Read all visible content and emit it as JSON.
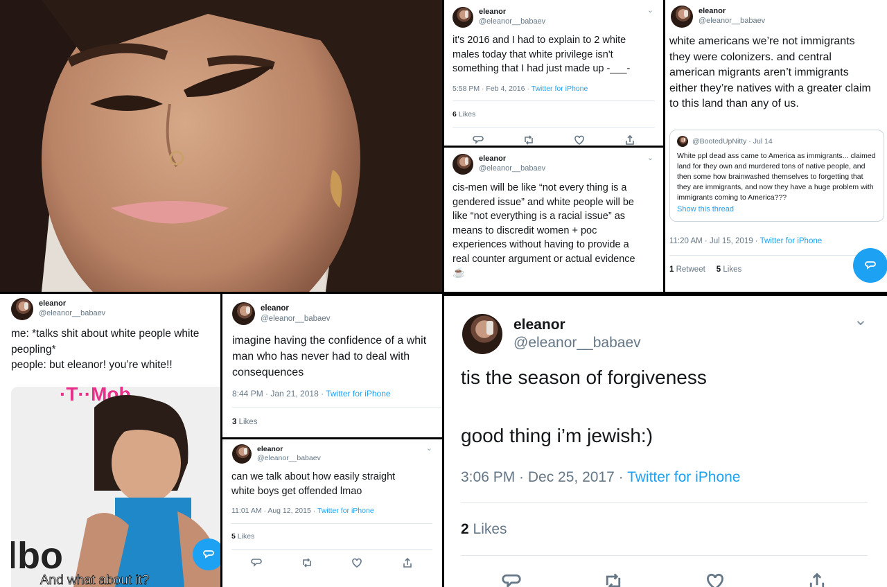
{
  "user": {
    "name": "eleanor",
    "handle": "@eleanor__babaev"
  },
  "p2": {
    "text": "it's 2016 and I had to explain to 2 white\nmales today that white privilege isn't\nsomething that I had just made up -___-",
    "time": "5:58 PM · Feb 4, 2016 · ",
    "source": "Twitter for iPhone",
    "like_count": "6",
    "like_label": "Likes"
  },
  "p3": {
    "text": "white americans we’re not immigrants\nthey were colonizers. and central\namerican migrants aren’t immigrants\neither they’re natives with a greater claim\nto this land than any of us.",
    "quote_handle": "@BootedUpNitty",
    "quote_date": "· Jul 14",
    "quote_text": "White ppl dead ass came to America as immigrants... claimed land for they own and murdered tons of native people, and then some how brainwashed themselves to forgetting that they are immigrants, and now they have a huge problem with immigrants coming to America???",
    "quote_link": "Show this thread",
    "time": "11:20 AM · Jul 15, 2019 · ",
    "source": "Twitter for iPhone",
    "retweet_count": "1",
    "retweet_label": "Retweet",
    "like_count": "5",
    "like_label": "Likes"
  },
  "p4": {
    "text": "cis-men will be like “not every thing is a\ngendered issue” and white people will be\nlike “not everything is a racial issue” as\nmeans to discredit women + poc\nexperiences without having to provide a\nreal counter argument or actual evidence\n☕"
  },
  "p5": {
    "text": "me: *talks shit about white people white\npeopling*\npeople: but eleanor! you’re white!!",
    "gif_caption": "And what about it?"
  },
  "p6": {
    "text": "imagine having the confidence of a whit\nman who has never had to deal with\nconsequences",
    "time": "8:44 PM · Jan 21, 2018 · ",
    "source": "Twitter for iPhone",
    "like_count": "3",
    "like_label": "Likes"
  },
  "p7": {
    "text": "can we talk about how easily straight\nwhite boys get offended lmao",
    "time": "11:01 AM · Aug 12, 2015 · ",
    "source": "Twitter for iPhone",
    "like_count": "5",
    "like_label": "Likes"
  },
  "p8": {
    "text": "tis the season of forgiveness\n\n\ngood thing i’m jewish:)",
    "time": "3:06 PM · Dec 25, 2017 · ",
    "source": "Twitter for iPhone",
    "like_count": "2",
    "like_label": "Likes"
  },
  "icons": [
    "reply-icon",
    "retweet-icon",
    "like-icon",
    "share-icon",
    "chevron-down-icon",
    "compose-reply-icon"
  ],
  "colors": {
    "accent": "#1da1f2",
    "muted": "#657786",
    "text": "#14171a"
  }
}
